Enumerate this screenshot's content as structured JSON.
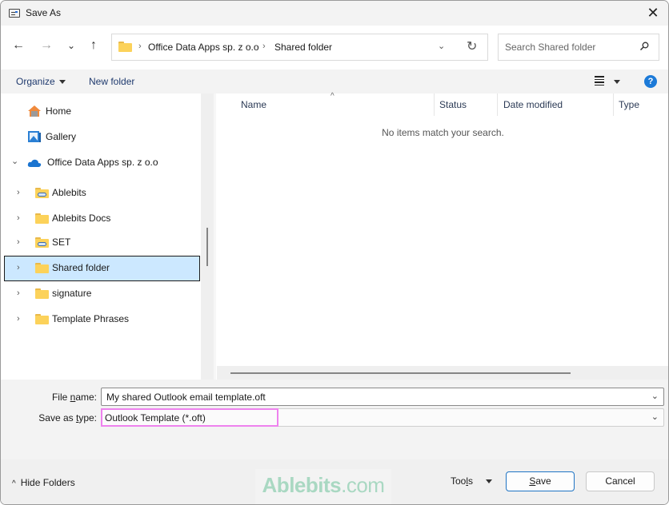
{
  "window": {
    "title": "Save As",
    "close_label": "✕"
  },
  "nav": {
    "back_icon": "←",
    "forward_icon": "→",
    "recent_icon": "⌄",
    "up_icon": "↑",
    "breadcrumb": [
      "Office Data Apps sp. z o.o",
      "Shared folder"
    ],
    "separator": "›",
    "dropdown_icon": "⌄",
    "refresh_icon": "↻",
    "search_placeholder": "Search Shared folder"
  },
  "toolbar": {
    "organize_label": "Organize",
    "new_folder_label": "New folder",
    "help_label": "?"
  },
  "sidebar": {
    "items": [
      {
        "label": "Home",
        "icon": "home-icon",
        "expandable": false
      },
      {
        "label": "Gallery",
        "icon": "gallery-icon",
        "expandable": false
      },
      {
        "label": "Office Data Apps sp. z o.o",
        "icon": "onedrive-cloud-icon",
        "expandable": true,
        "expanded": true
      },
      {
        "label": "Ablebits",
        "icon": "shared-folder-icon",
        "expandable": true
      },
      {
        "label": "Ablebits Docs",
        "icon": "folder-icon",
        "expandable": true
      },
      {
        "label": "SET",
        "icon": "shared-folder-icon",
        "expandable": true
      },
      {
        "label": "Shared folder",
        "icon": "folder-icon",
        "expandable": true,
        "selected": true
      },
      {
        "label": "signature",
        "icon": "folder-icon",
        "expandable": true
      },
      {
        "label": "Template Phrases",
        "icon": "folder-icon",
        "expandable": true
      }
    ],
    "chevron_right": "›",
    "chevron_down": "⌄"
  },
  "filelist": {
    "columns": [
      "Name",
      "Status",
      "Date modified",
      "Type"
    ],
    "sort_indicator": "^",
    "empty_message": "No items match your search."
  },
  "form": {
    "file_name_label_pre": "File ",
    "file_name_label_u": "n",
    "file_name_label_post": "ame:",
    "file_name_value": "My shared Outlook email template.oft",
    "save_type_label_pre": "Save as ",
    "save_type_label_u": "t",
    "save_type_label_post": "ype:",
    "save_type_value": "Outlook Template (*.oft)",
    "dropdown_icon": "⌄"
  },
  "footer": {
    "hide_folders_label": "Hide Folders",
    "hide_folders_icon": "^",
    "watermark_main": "Ablebits",
    "watermark_suffix": ".com",
    "tools_pre": "Too",
    "tools_u": "l",
    "tools_post": "s",
    "save_u": "S",
    "save_post": "ave",
    "cancel_label": "Cancel"
  }
}
